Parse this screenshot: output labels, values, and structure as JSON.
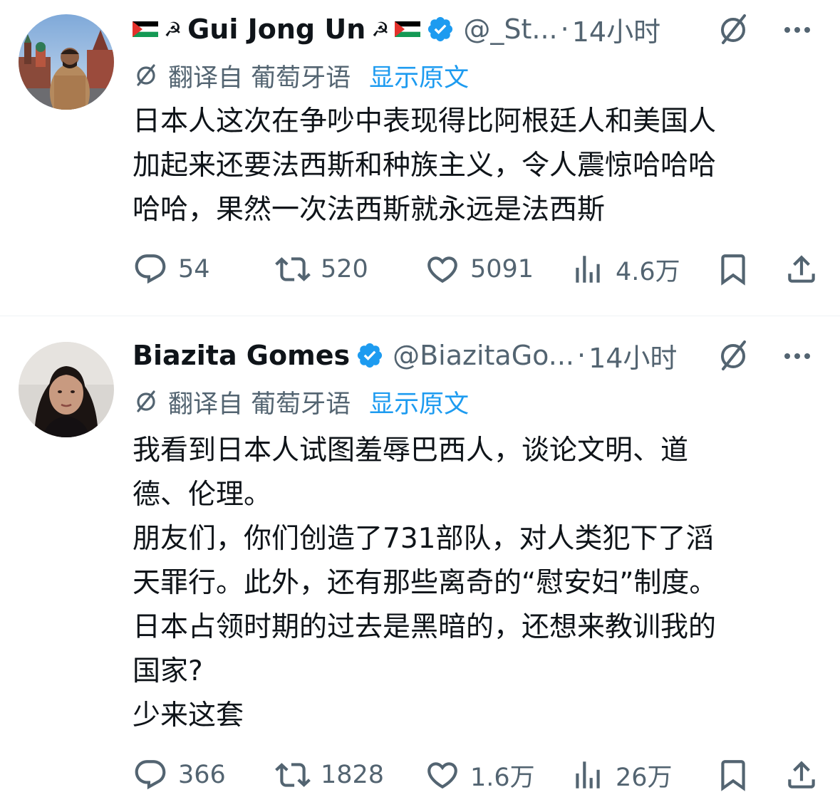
{
  "tweets": [
    {
      "display_name": "Gui Jong Un",
      "handle": "@_St...",
      "separator": "·",
      "time": "14小时",
      "translation": {
        "label": "翻译自 葡萄牙语",
        "show_original": "显示原文"
      },
      "text_lines": [
        "日本人这次在争吵中表现得比阿根廷人和美国人",
        "加起来还要法西斯和种族主义，令人震惊哈哈哈",
        "哈哈，果然一次法西斯就永远是法西斯"
      ],
      "stats": {
        "replies": "54",
        "retweets": "520",
        "likes": "5091",
        "views": "4.6万"
      },
      "name_decorations": [
        "palestine-flag",
        "hammer-sickle"
      ]
    },
    {
      "display_name": "Biazita Gomes",
      "handle": "@BiazitaGo...",
      "separator": "·",
      "time": "14小时",
      "translation": {
        "label": "翻译自 葡萄牙语",
        "show_original": "显示原文"
      },
      "text_lines": [
        "我看到日本人试图羞辱巴西人，谈论文明、道",
        "德、伦理。",
        "朋友们，你们创造了731部队，对人类犯下了滔",
        "天罪行。此外，还有那些离奇的“慰安妇”制度。",
        "日本占领时期的过去是黑暗的，还想来教训我的",
        "国家?",
        "少来这套"
      ],
      "stats": {
        "replies": "366",
        "retweets": "1828",
        "likes": "1.6万",
        "views": "26万"
      }
    }
  ],
  "colors": {
    "text_primary": "#0f1419",
    "text_secondary": "#536471",
    "link": "#1d9bf0",
    "verified": "#1d9bf0"
  }
}
